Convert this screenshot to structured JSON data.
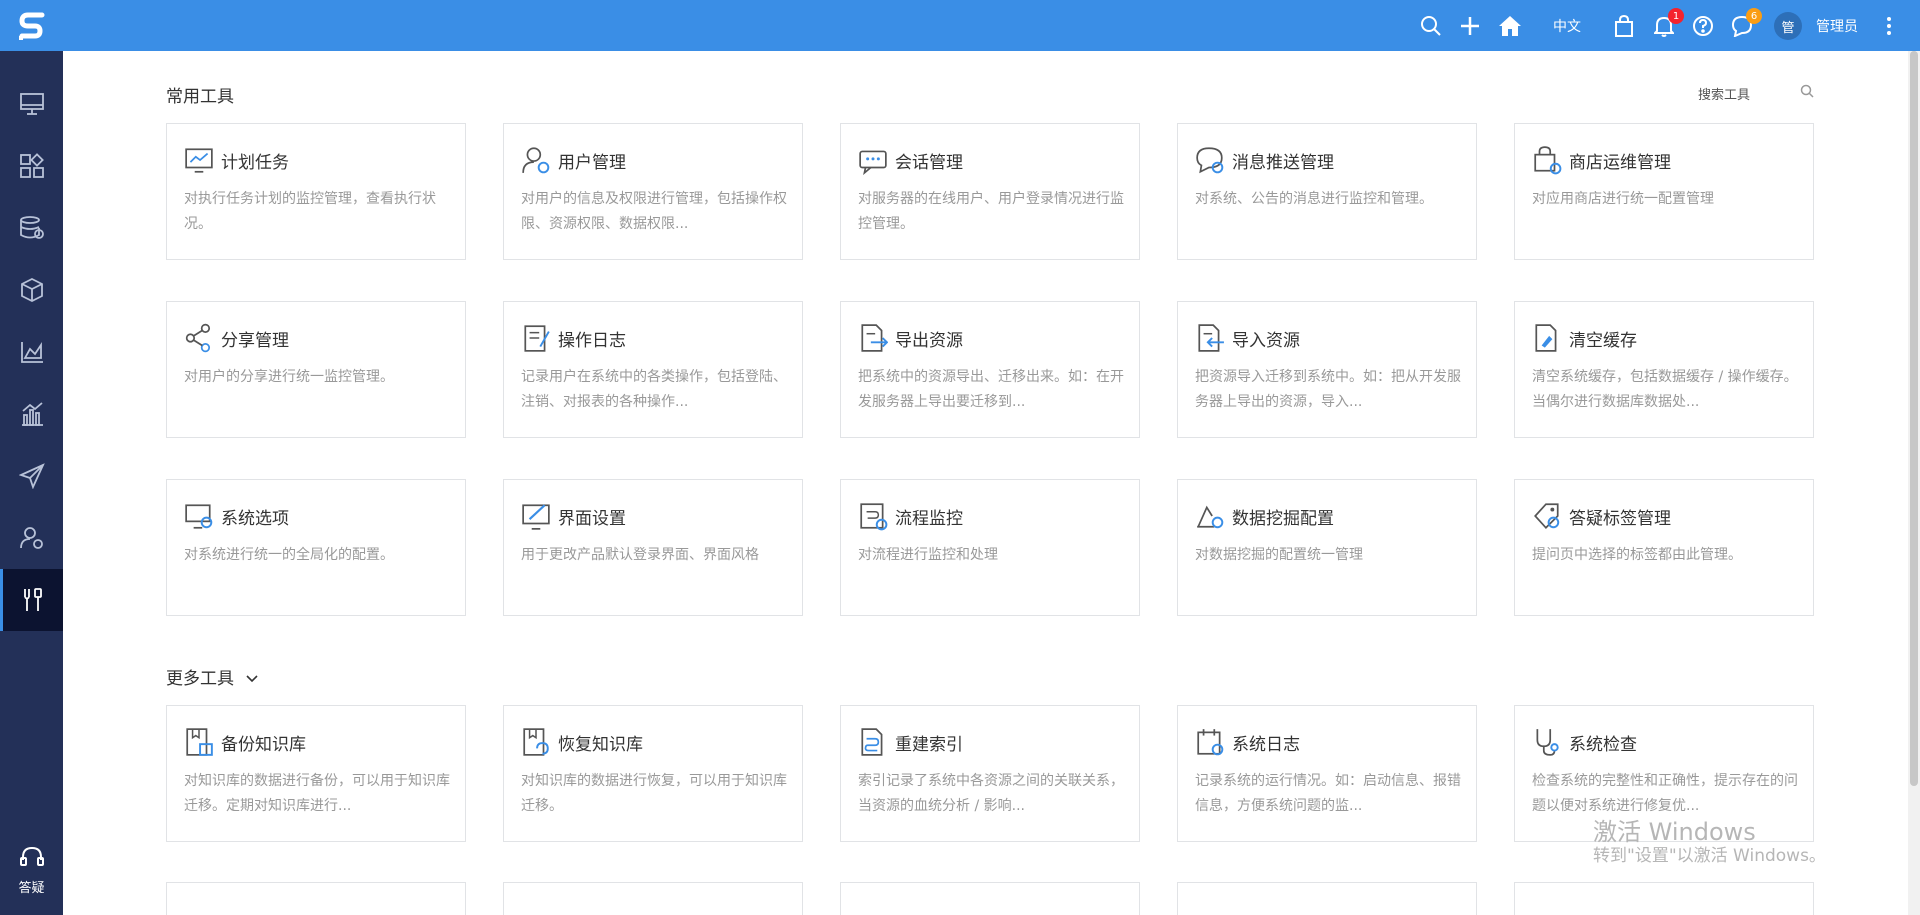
{
  "topbar": {
    "language": "中文",
    "notification_count": "1",
    "message_count": "6",
    "avatar_text": "管",
    "username": "管理员"
  },
  "sidebar": {
    "help_label": "答疑"
  },
  "common_tools": {
    "title": "常用工具",
    "search_label": "搜索工具",
    "cards": [
      {
        "title": "计划任务",
        "desc": "对执行任务计划的监控管理，查看执行状况。"
      },
      {
        "title": "用户管理",
        "desc": "对用户的信息及权限进行管理，包括操作权限、资源权限、数据权限..."
      },
      {
        "title": "会话管理",
        "desc": "对服务器的在线用户、用户登录情况进行监控管理。"
      },
      {
        "title": "消息推送管理",
        "desc": "对系统、公告的消息进行监控和管理。"
      },
      {
        "title": "商店运维管理",
        "desc": "对应用商店进行统一配置管理"
      },
      {
        "title": "分享管理",
        "desc": "对用户的分享进行统一监控管理。"
      },
      {
        "title": "操作日志",
        "desc": "记录用户在系统中的各类操作，包括登陆、注销、对报表的各种操作..."
      },
      {
        "title": "导出资源",
        "desc": "把系统中的资源导出、迁移出来。如：在开发服务器上导出要迁移到..."
      },
      {
        "title": "导入资源",
        "desc": "把资源导入迁移到系统中。如：把从开发服务器上导出的资源，导入..."
      },
      {
        "title": "清空缓存",
        "desc": "清空系统缓存，包括数据缓存 / 操作缓存。当偶尔进行数据库数据处..."
      },
      {
        "title": "系统选项",
        "desc": "对系统进行统一的全局化的配置。"
      },
      {
        "title": "界面设置",
        "desc": "用于更改产品默认登录界面、界面风格"
      },
      {
        "title": "流程监控",
        "desc": "对流程进行监控和处理"
      },
      {
        "title": "数据挖掘配置",
        "desc": "对数据挖掘的配置统一管理"
      },
      {
        "title": "答疑标签管理",
        "desc": "提问页中选择的标签都由此管理。"
      }
    ]
  },
  "more_tools": {
    "title": "更多工具",
    "cards": [
      {
        "title": "备份知识库",
        "desc": "对知识库的数据进行备份，可以用于知识库迁移。定期对知识库进行..."
      },
      {
        "title": "恢复知识库",
        "desc": "对知识库的数据进行恢复，可以用于知识库迁移。"
      },
      {
        "title": "重建索引",
        "desc": "索引记录了系统中各资源之间的关联关系，当资源的血统分析 / 影响..."
      },
      {
        "title": "系统日志",
        "desc": "记录系统的运行情况。如：启动信息、报错信息，方便系统问题的监..."
      },
      {
        "title": "系统检查",
        "desc": "检查系统的完整性和正确性，提示存在的问题以便对系统进行修复优..."
      }
    ]
  },
  "watermark": {
    "line1": "激活 Windows",
    "line2": "转到\"设置\"以激活 Windows。"
  },
  "colors": {
    "brand_blue": "#3a8ee6",
    "sidebar_bg": "#233058",
    "badge_red": "#f5222d",
    "badge_orange": "#fa9d14"
  }
}
